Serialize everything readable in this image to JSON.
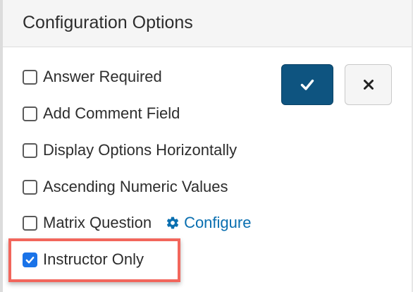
{
  "header": {
    "title": "Configuration Options"
  },
  "options": [
    {
      "label": "Answer Required",
      "checked": false
    },
    {
      "label": "Add Comment Field",
      "checked": false
    },
    {
      "label": "Display Options Horizontally",
      "checked": false
    },
    {
      "label": "Ascending Numeric Values",
      "checked": false
    },
    {
      "label": "Matrix Question",
      "checked": false
    },
    {
      "label": "Instructor Only",
      "checked": true
    }
  ],
  "matrix_configure": {
    "label": "Configure",
    "icon": "gear-icon",
    "color": "#0a6fb0"
  },
  "buttons": {
    "confirm_icon": "checkmark-icon",
    "cancel_icon": "close-icon",
    "confirm_color": "#0e5480"
  },
  "colors": {
    "highlight": "#f2665c",
    "checkbox_checked": "#1a73e8"
  }
}
